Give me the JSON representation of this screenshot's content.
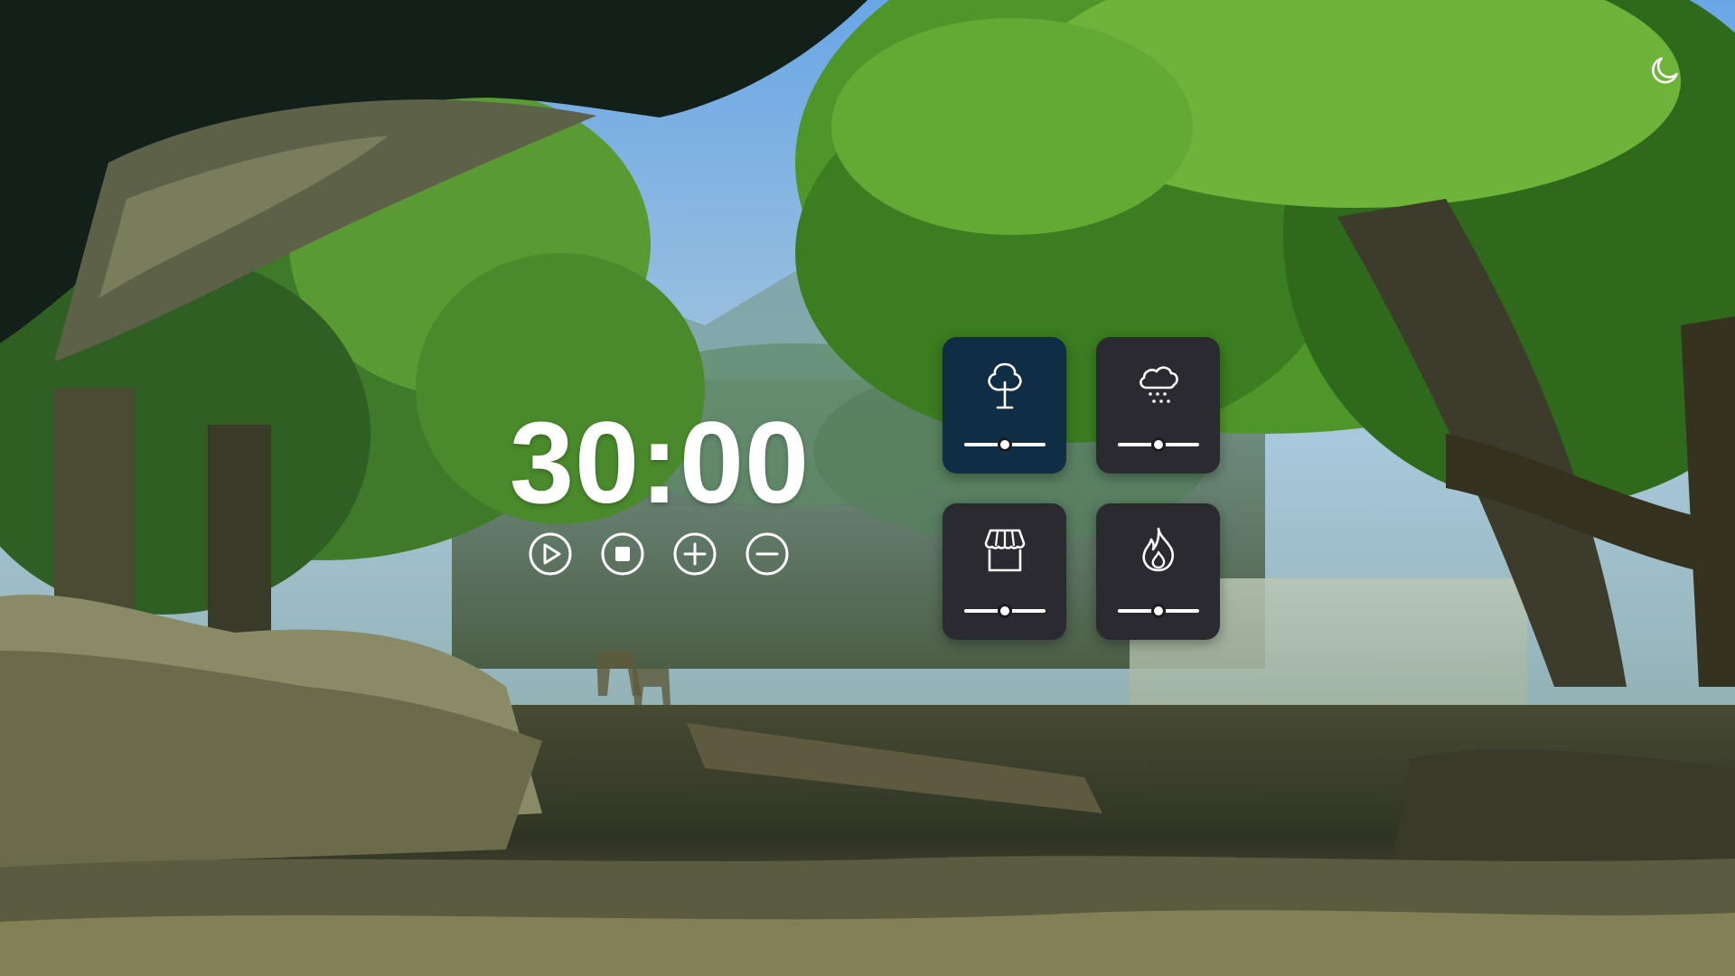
{
  "timer": {
    "display": "30:00"
  },
  "controls": [
    {
      "name": "play-button",
      "icon": "play-icon"
    },
    {
      "name": "stop-button",
      "icon": "stop-icon"
    },
    {
      "name": "increase-time-button",
      "icon": "plus-icon"
    },
    {
      "name": "decrease-time-button",
      "icon": "minus-icon"
    }
  ],
  "header": {
    "theme_toggle_icon": "moon-icon"
  },
  "sounds": [
    {
      "name": "forest",
      "icon": "tree-icon",
      "active": true,
      "volume": 0.5
    },
    {
      "name": "rain",
      "icon": "rain-cloud-icon",
      "active": false,
      "volume": 0.5
    },
    {
      "name": "cafe",
      "icon": "storefront-icon",
      "active": false,
      "volume": 0.5
    },
    {
      "name": "fireplace",
      "icon": "flame-icon",
      "active": false,
      "volume": 0.5
    }
  ],
  "colors": {
    "tile_default": "#2b2a31",
    "tile_active": "#0f2e45",
    "text": "#ffffff"
  }
}
